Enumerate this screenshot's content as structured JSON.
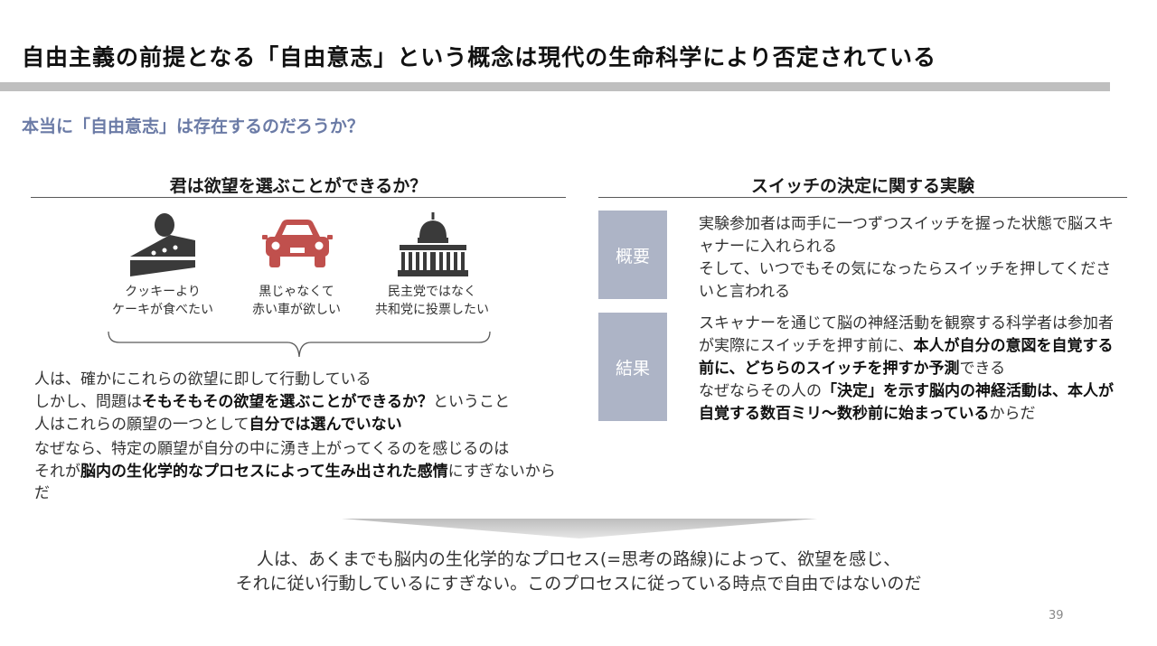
{
  "header": {
    "title": "自由主義の前提となる「自由意志」という概念は現代の生命科学により否定されている",
    "subtitle": "本当に「自由意志」は存在するのだろうか？"
  },
  "left": {
    "heading": "君は欲望を選ぶことができるか？",
    "icons": [
      {
        "icon": "cake-icon",
        "line1": "クッキーより",
        "line2": "ケーキが食べたい"
      },
      {
        "icon": "car-icon",
        "line1": "黒じゃなくて",
        "line2": "赤い車が欲しい"
      },
      {
        "icon": "capitol-icon",
        "line1": "民主党ではなく",
        "line2": "共和党に投票したい"
      }
    ],
    "body": {
      "l1": "人は、確かにこれらの欲望に即して行動している",
      "l2a": "しかし、問題は",
      "l2b": "そもそもその欲望を選ぶことができるか？",
      "l2c": "ということ",
      "l3a": "人はこれらの願望の一つとして",
      "l3b": "自分では選んでいない",
      "l4": "なぜなら、特定の願望が自分の中に湧き上がってくるのを感じるのは",
      "l5a": "それが",
      "l5b": "脳内の生化学的なプロセスによって生み出された感情",
      "l5c": "にすぎないからだ"
    }
  },
  "right": {
    "heading": "スイッチの決定に関する実験",
    "overview": {
      "label": "概要",
      "l1": "実験参加者は両手に一つずつスイッチを握った状態で脳スキャナーに入れられる",
      "l2": "そして、いつでもその気になったらスイッチを押してくださいと言われる"
    },
    "result": {
      "label": "結果",
      "p1a": "スキャナーを通じて脳の神経活動を観察する科学者は参加者が実際にスイッチを押す前に、",
      "p1b": "本人が自分の意図を自覚する前に、どちらのスイッチを押すか予測",
      "p1c": "できる",
      "p2a": "なぜならその人の",
      "p2b": "「決定」を示す脳内の神経活動は、本人が自覚する数百ミリ〜数秒前に始まっている",
      "p2c": "からだ"
    }
  },
  "conclusion": {
    "line1": "人は、あくまでも脳内の生化学的なプロセス(=思考の路線)によって、欲望を感じ、",
    "line2": "それに従い行動しているにすぎない。このプロセスに従っている時点で自由ではないのだ"
  },
  "page_number": "39",
  "colors": {
    "accent_subtitle": "#6b7ba6",
    "label_box": "#adb4c6",
    "car_red": "#c0504d",
    "icon_dark": "#3a3a3a"
  }
}
